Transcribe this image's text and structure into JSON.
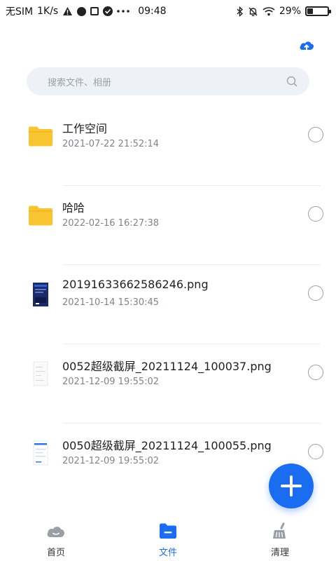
{
  "status_bar": {
    "carrier": "无SIM",
    "speed": "1K/s",
    "time": "09:48",
    "battery": "29%",
    "battery_level": 0.29
  },
  "search": {
    "placeholder": "搜索文件、相册"
  },
  "files": [
    {
      "name": "工作空间",
      "date": "2021-07-22 21:52:14",
      "kind": "folder"
    },
    {
      "name": "哈哈",
      "date": "2022-02-16 16:27:38",
      "kind": "folder"
    },
    {
      "name": "20191633662586246.png",
      "date": "2021-10-14 15:30:45",
      "kind": "image-dark"
    },
    {
      "name": "0052超级截屏_20211124_100037.png",
      "date": "2021-12-09 19:55:02",
      "kind": "image-light"
    },
    {
      "name": "0050超级截屏_20211124_100055.png",
      "date": "2021-12-09 19:55:02",
      "kind": "image-doc"
    }
  ],
  "bottom_nav": {
    "home": "首页",
    "files": "文件",
    "clean": "清理",
    "active": "files"
  },
  "colors": {
    "accent": "#1a6cf0",
    "folder": "#f8c531"
  }
}
